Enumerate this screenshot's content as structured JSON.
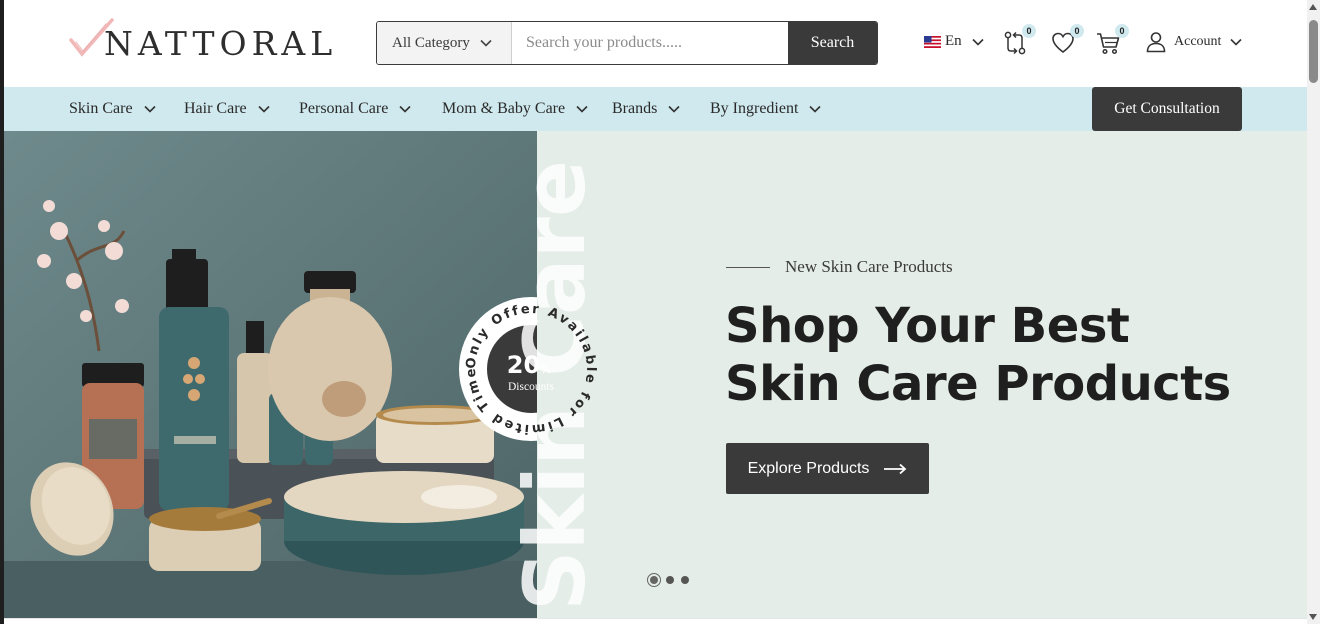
{
  "brand": {
    "name": "NATTORAL"
  },
  "search": {
    "category_label": "All Category",
    "placeholder": "Search your products.....",
    "button_label": "Search"
  },
  "header": {
    "language": "En",
    "compare_count": "0",
    "wishlist_count": "0",
    "cart_count": "0",
    "account_label": "Account"
  },
  "nav": {
    "items": [
      {
        "label": "Skin Care"
      },
      {
        "label": "Hair Care"
      },
      {
        "label": "Personal Care"
      },
      {
        "label": "Mom & Baby Care"
      },
      {
        "label": "Brands"
      },
      {
        "label": "By Ingredient"
      }
    ],
    "cta_label": "Get Consultation"
  },
  "hero": {
    "vertical_text": "Skin Care",
    "badge_percent": "20",
    "badge_percent_sign": "%",
    "badge_sub": "Discounts",
    "badge_ring_text": "Only Offer Available for Limited Time",
    "pretitle": "New Skin Care Products",
    "headline_line1": "Shop Your Best",
    "headline_line2": "Skin Care Products",
    "cta_label": "Explore Products",
    "slides_total": 3,
    "active_slide": 1
  },
  "colors": {
    "nav_bg": "#cfe9ee",
    "hero_bg": "#e4ede7",
    "dark_button": "#3a3a3a",
    "badge_bg": "#cfe9ee"
  },
  "icons": [
    "check-logo-icon",
    "chevron-down-icon",
    "us-flag-icon",
    "compare-icon",
    "heart-icon",
    "cart-icon",
    "user-icon",
    "arrow-right-icon"
  ]
}
